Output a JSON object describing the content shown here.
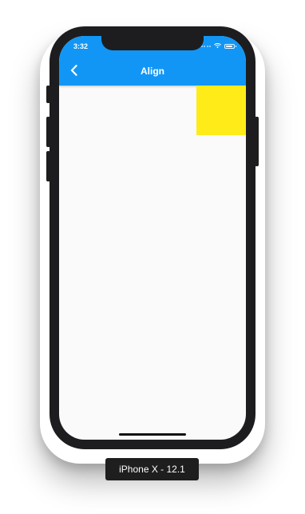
{
  "status_bar": {
    "time": "3:32"
  },
  "app_bar": {
    "title": "Align",
    "back_icon": "chevron-left-icon",
    "color": "#1196f5"
  },
  "content": {
    "box_color": "#ffeb17",
    "background": "#fafafa"
  },
  "device": {
    "label": "iPhone X - 12.1",
    "frame_color": "#1d1d1f"
  }
}
